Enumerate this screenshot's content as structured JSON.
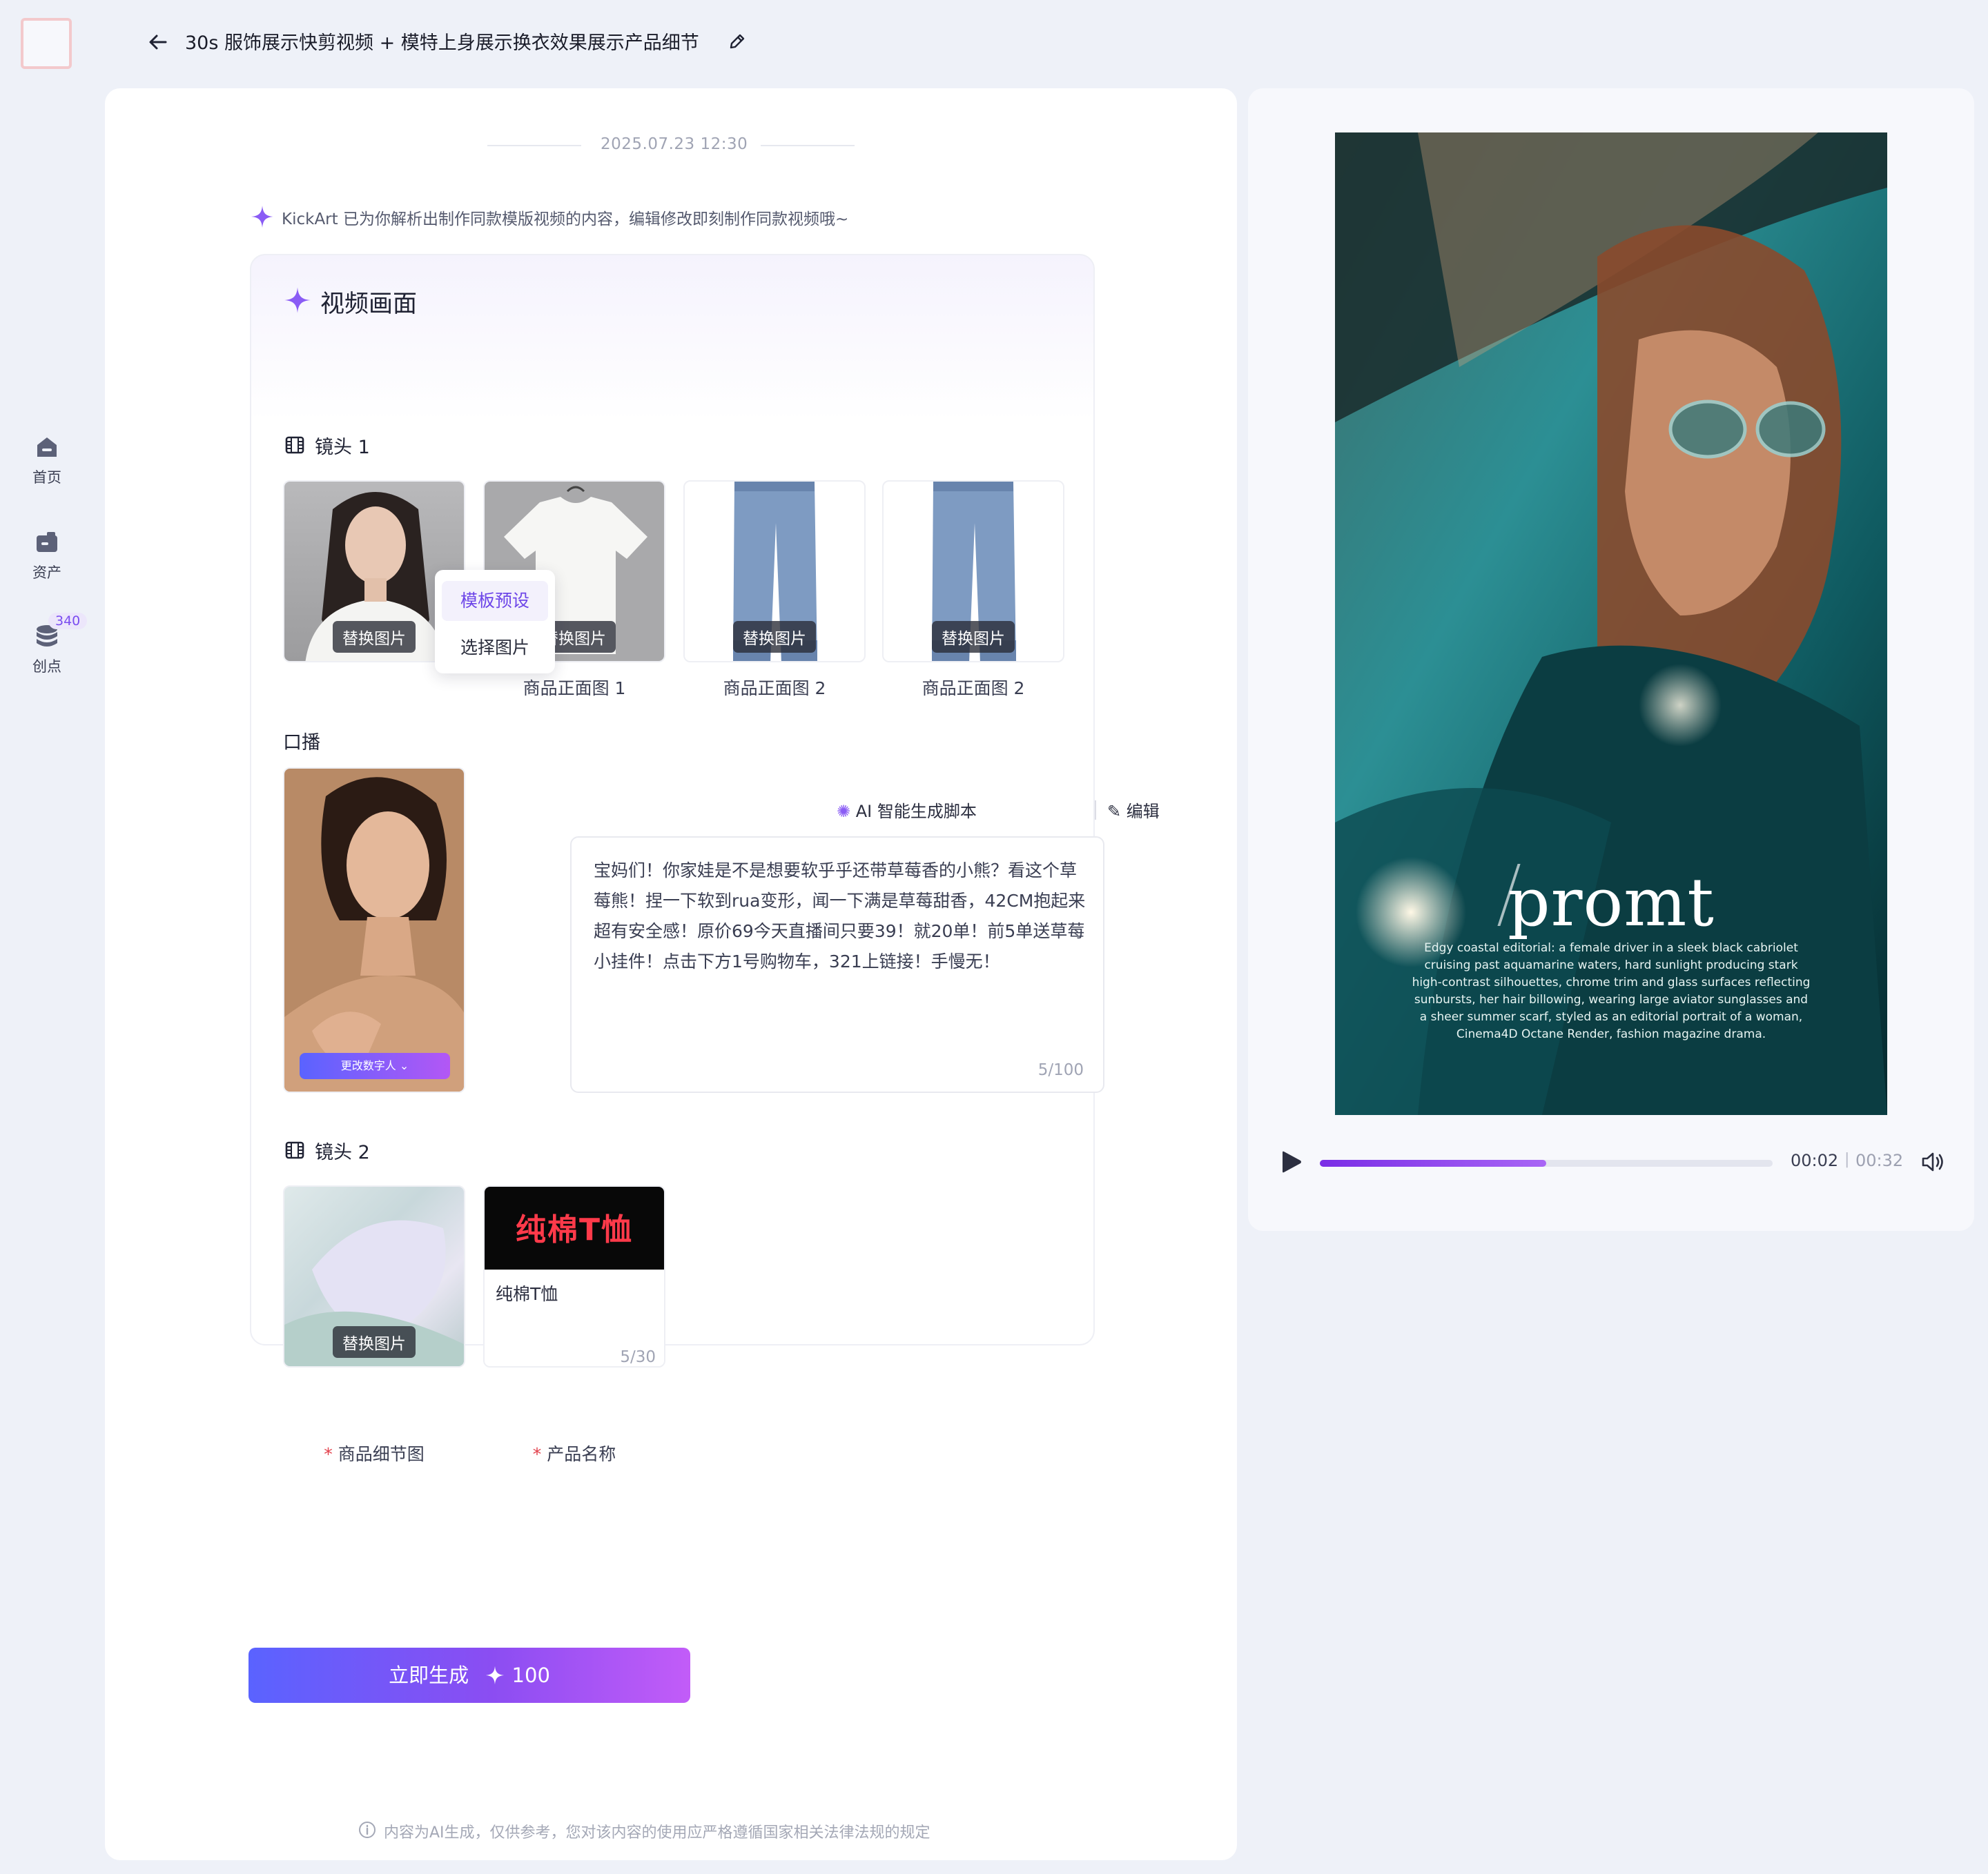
{
  "nav": {
    "items": [
      {
        "label": "首页",
        "icon": "home-icon"
      },
      {
        "label": "资产",
        "icon": "assets-icon"
      },
      {
        "label": "创点",
        "icon": "credits-icon"
      }
    ],
    "credits_badge": "340"
  },
  "header": {
    "title": "30s 服饰展示快剪视频 + 模特上身展示换衣效果展示产品细节"
  },
  "chat": {
    "date": "2025.07.23  12:30",
    "ai_note": "KickArt 已为你解析出制作同款模版视频的内容，编辑修改即刻制作同款视频哦~"
  },
  "card": {
    "title": "视频画面",
    "shot1": {
      "label": "镜头 1",
      "replace_label": "替换图片",
      "thumbs": [
        {
          "caption": ""
        },
        {
          "caption": "商品正面图 1"
        },
        {
          "caption": "商品正面图 2"
        },
        {
          "caption": "商品正面图 2"
        }
      ],
      "dropdown": [
        "模板预设",
        "选择图片"
      ]
    },
    "voice": {
      "label": "口播",
      "change_avatar": "更改数字人",
      "ai_script_label": "AI 智能生成脚本",
      "edit_label": "编辑",
      "script": "宝妈们！你家娃是不是想要软乎乎还带草莓香的小熊？看这个草莓熊！捏一下软到rua变形，闻一下满是草莓甜香，42CM抱起来超有安全感！原价69今天直播间只要39！就20单！前5单送草莓小挂件！点击下方1号购物车，321上链接！手慢无！",
      "count": "5/100"
    },
    "shot2": {
      "label": "镜头 2",
      "replace_label": "替换图片",
      "detail_caption": "商品细节图",
      "name_caption": "产品名称",
      "banner_text": "纯棉T恤",
      "name_value": "纯棉T恤",
      "name_count": "5/30"
    }
  },
  "generate": {
    "label": "立即生成",
    "cost": "100"
  },
  "disclaimer": "内容为AI生成，仅供参考，您对该内容的使用应严格遵循国家相关法律法规的规定",
  "preview": {
    "overlay_title": "promt",
    "overlay_desc": "Edgy coastal editorial: a female driver in a sleek black cabriolet cruising past aquamarine waters, hard sunlight producing stark high-contrast silhouettes, chrome trim and glass surfaces reflecting sunbursts, her hair billowing, wearing large aviator sunglasses and a sheer summer scarf, styled as an editorial portrait of a woman, Cinema4D Octane Render, fashion magazine drama.",
    "time_current": "00:02",
    "time_separator": "|",
    "time_total": "00:32",
    "progress": 0.5
  },
  "colors": {
    "accent": "#7a4cf0",
    "background": "#eef1f8",
    "required": "#e23f4a"
  }
}
